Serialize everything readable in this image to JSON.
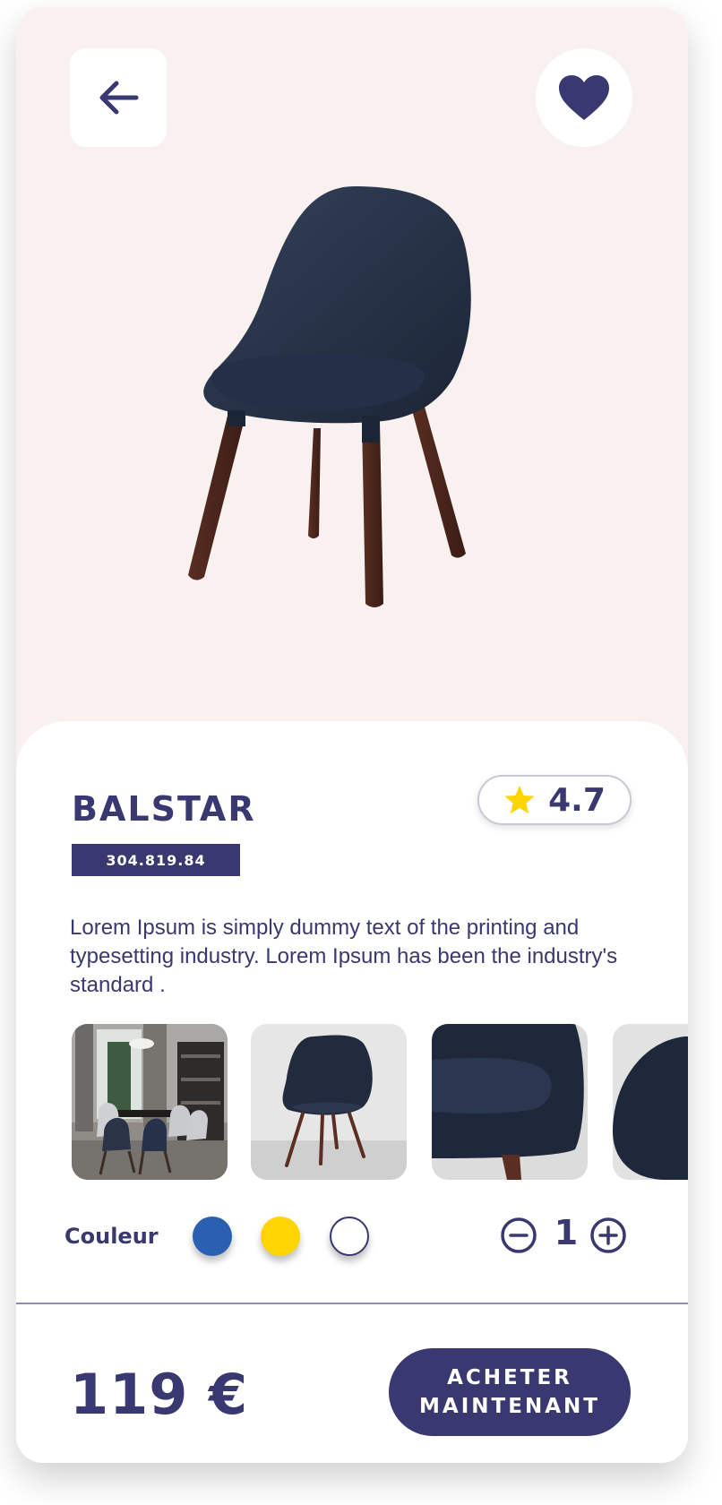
{
  "product": {
    "name": "BALSTAR",
    "sku": "304.819.84",
    "rating": "4.7",
    "description": "Lorem Ipsum is simply dummy text of the printing and typesetting industry. Lorem Ipsum has been the industry's standard .",
    "price": "119 €"
  },
  "options": {
    "color_label": "Couleur",
    "colors": [
      "#2b5fb0",
      "#ffd400",
      "#ffffff"
    ],
    "quantity": "1"
  },
  "actions": {
    "buy_label": "ACHETER MAINTENANT"
  },
  "icons": [
    "arrow-left-icon",
    "heart-icon",
    "star-icon",
    "minus-circle-icon",
    "plus-circle-icon"
  ],
  "theme": {
    "primary": "#3a3870",
    "hero_bg": "#f9f1f0",
    "star": "#ffd400"
  }
}
